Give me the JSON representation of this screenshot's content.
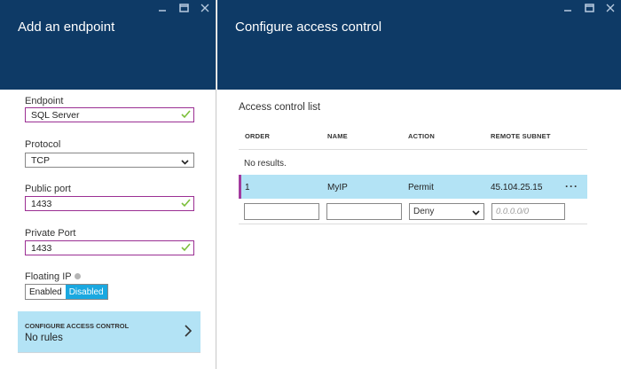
{
  "left_blade": {
    "title": "Add an endpoint",
    "fields": {
      "endpoint_label": "Endpoint",
      "endpoint_value": "SQL Server",
      "protocol_label": "Protocol",
      "protocol_value": "TCP",
      "public_port_label": "Public port",
      "public_port_value": "1433",
      "private_port_label": "Private Port",
      "private_port_value": "1433",
      "floating_ip_label": "Floating IP",
      "floating_ip_options": [
        "Enabled",
        "Disabled"
      ],
      "floating_ip_selected": "Disabled"
    },
    "nav": {
      "title": "CONFIGURE ACCESS CONTROL",
      "value": "No rules"
    }
  },
  "right_blade": {
    "title": "Configure access control",
    "acl_title": "Access control list",
    "columns": [
      "ORDER",
      "NAME",
      "ACTION",
      "REMOTE SUBNET"
    ],
    "no_results": "No results.",
    "rows": [
      {
        "order": "1",
        "name": "MyIP",
        "action": "Permit",
        "subnet": "45.104.25.15",
        "more": "···"
      }
    ],
    "new_row": {
      "order_value": "",
      "name_value": "",
      "action_value": "Deny",
      "subnet_placeholder": "0.0.0.0/0"
    }
  },
  "colors": {
    "header_bg": "#0e3a66",
    "selection_bg": "#b3e3f5",
    "toggle_on": "#1aa8e0",
    "valid_border": "#9b2f93",
    "check_green": "#7cbf3a",
    "row_marker": "#a23a9e"
  },
  "icons": {
    "minimize": "minimize-icon",
    "maximize": "maximize-icon",
    "close": "close-icon",
    "check": "check-icon",
    "chevron_down": "chevron-down-icon",
    "chevron_right": "chevron-right-icon",
    "info": "info-icon"
  }
}
